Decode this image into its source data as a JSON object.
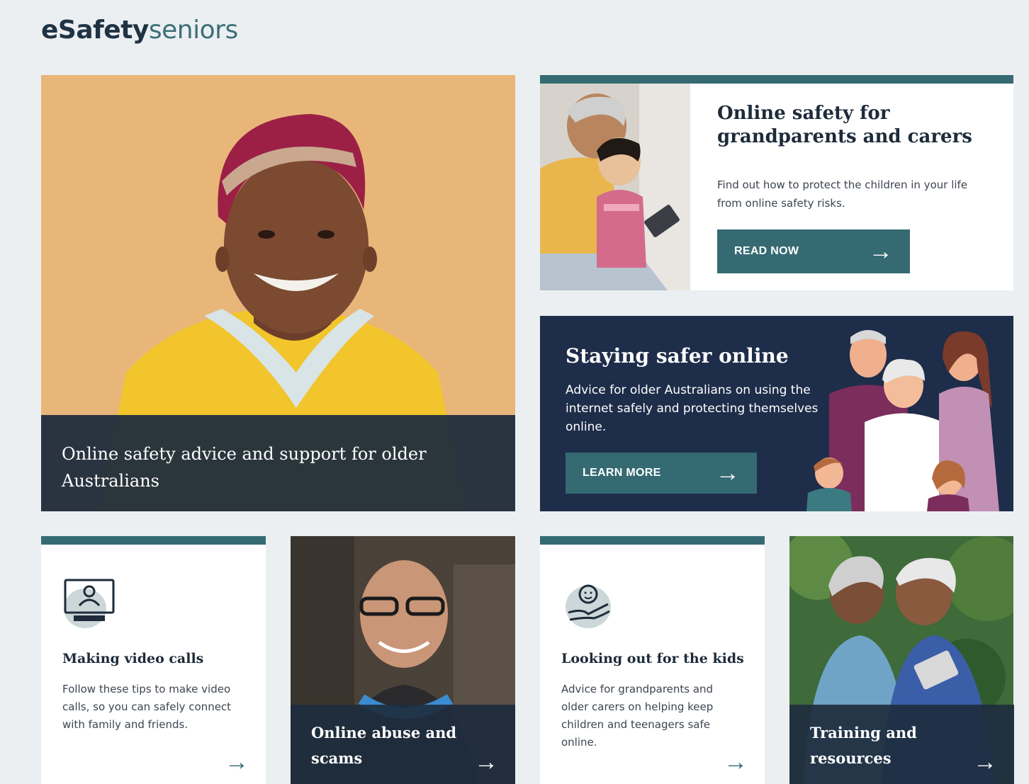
{
  "site": {
    "logo_bold": "eSafety",
    "logo_light": "seniors"
  },
  "hero": {
    "caption": "Online safety advice and support for older Australians"
  },
  "grandparents": {
    "title": "Online safety for grandparents and carers",
    "description": "Find out how to protect the children in your life from online safety risks.",
    "button_label": "READ NOW"
  },
  "staying_safer": {
    "title": "Staying safer online",
    "description": "Advice for older Australians on using the internet safely and protecting themselves online.",
    "button_label": "LEARN MORE"
  },
  "tiles": [
    {
      "title": "Making video calls",
      "description": "Follow these tips to make video calls, so you can safely connect with family and friends.",
      "icon": "video-call-icon"
    },
    {
      "title": "Online abuse and scams"
    },
    {
      "title": "Looking out for the kids",
      "description": "Advice for grandparents and older carers on helping keep children and teenagers safe online.",
      "icon": "child-care-icon"
    },
    {
      "title": "Training and resources"
    }
  ],
  "colors": {
    "teal": "#356a73",
    "navy": "#1e2d49",
    "bg": "#eceff2"
  }
}
